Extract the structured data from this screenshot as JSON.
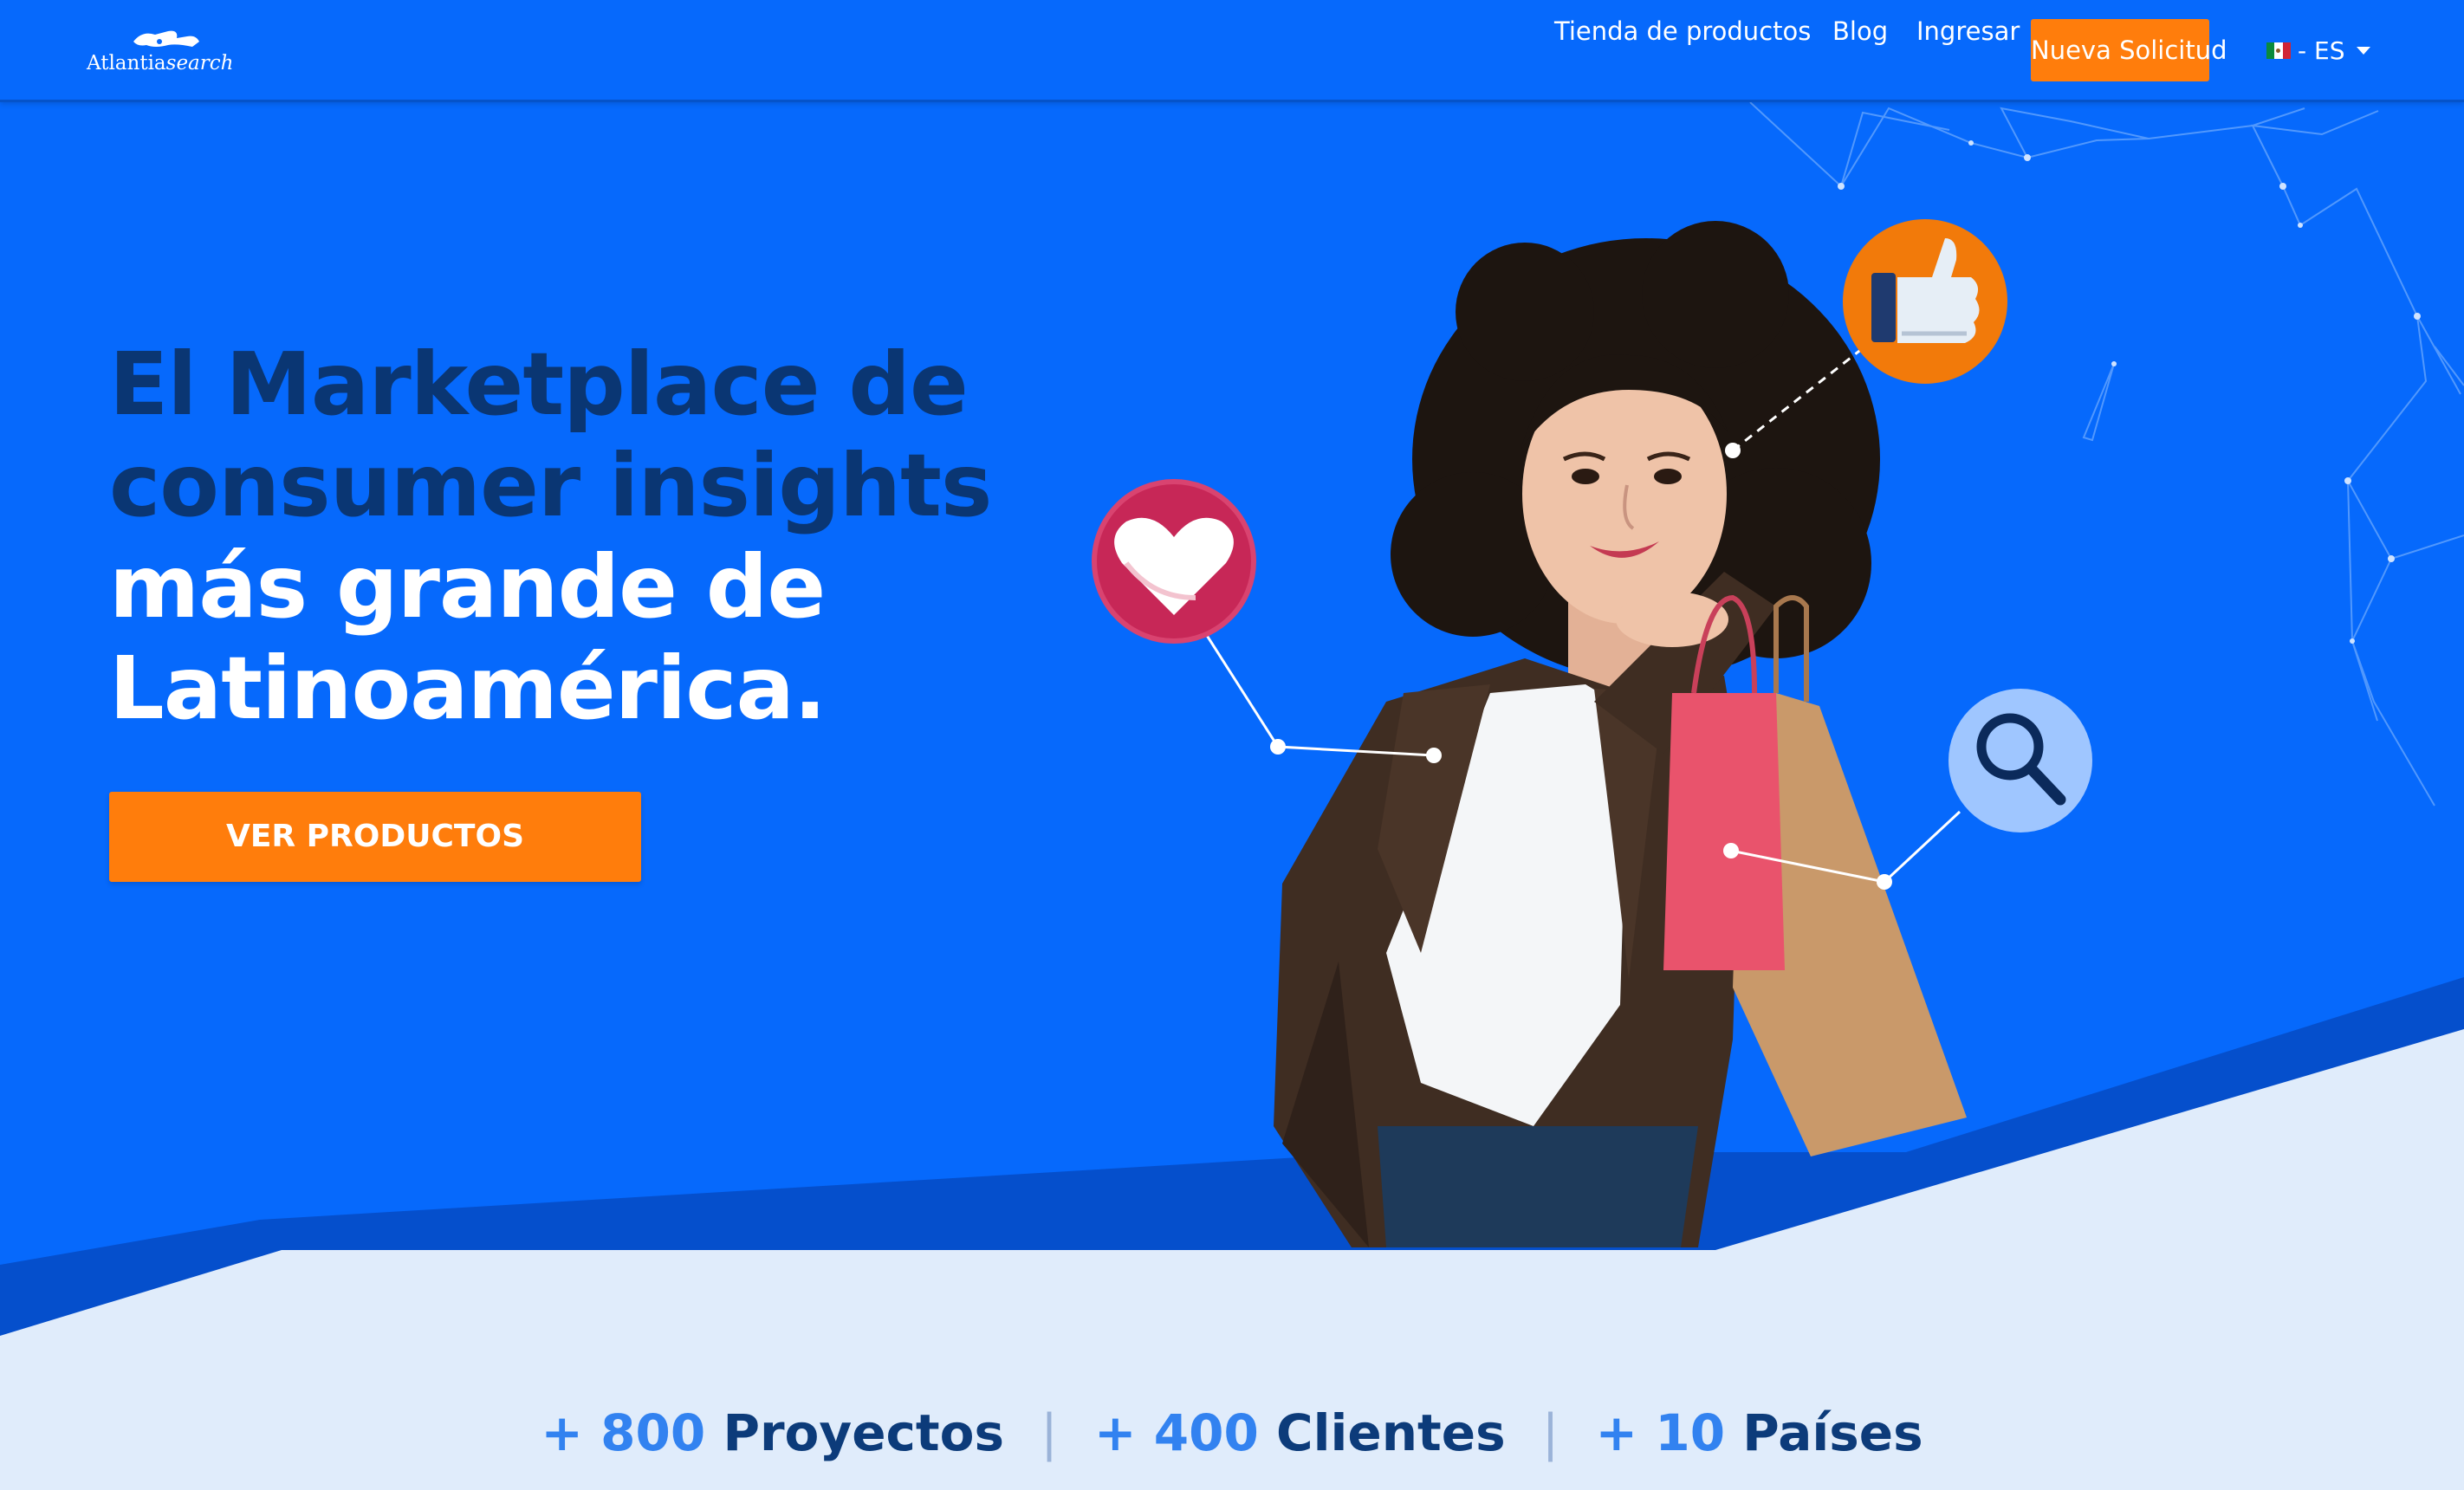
{
  "brand": {
    "name_part1": "Atlantia",
    "name_part2": "search"
  },
  "nav": {
    "links": [
      "Tienda de productos",
      "Blog",
      "Ingresar"
    ],
    "cta": "Nueva Solicitud",
    "language": "- ES"
  },
  "hero": {
    "headline_dark": [
      "El Marketplace de",
      "consumer insights"
    ],
    "headline_light": [
      "más grande de",
      "Latinoamérica."
    ],
    "cta": "VER PRODUCTOS"
  },
  "stats": [
    {
      "number": "+ 800",
      "label": "Proyectos"
    },
    {
      "number": "+ 400",
      "label": "Clientes"
    },
    {
      "number": "+ 10",
      "label": "Países"
    }
  ],
  "colors": {
    "primary": "#0669fc",
    "accent": "#ff7d0c",
    "heading_dark": "#0a3673",
    "light_band": "#e0ecfb",
    "stat_number": "#3282f0",
    "stat_label": "#0c3b7a"
  },
  "icons": [
    "heart-icon",
    "thumbs-up-icon",
    "search-icon",
    "mexico-flag-icon",
    "caret-down-icon",
    "world-map-logo-icon"
  ]
}
